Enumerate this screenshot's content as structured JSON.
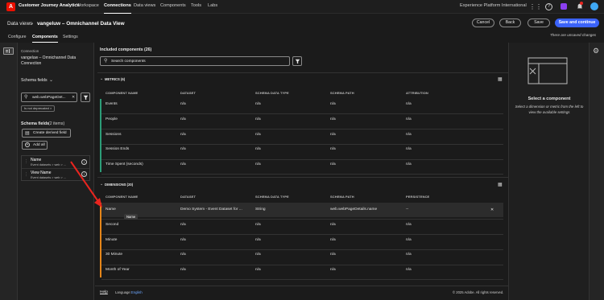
{
  "topnav": {
    "app_title": "Customer Journey Analytics",
    "tabs": [
      "Workspace",
      "Connections",
      "Data views",
      "Components",
      "Tools",
      "Labs"
    ],
    "org": "Experience Platform International",
    "logo_letter": "A"
  },
  "header": {
    "breadcrumb_root": "Data views",
    "breadcrumb_sep": "›",
    "title": "vangeluw – Omnichannel Data View",
    "tabs": [
      "Configure",
      "Components",
      "Settings"
    ],
    "cancel": "Cancel",
    "back": "Back",
    "save": "Save",
    "save_continue": "Save and continue",
    "unsaved": "There are unsaved changes"
  },
  "left": {
    "connection_label": "Connection",
    "connection_value": "vangeluw – Omnichannel Data Connection",
    "schema_dropdown": "Schema fields",
    "search_value": "web.webPageDet...",
    "filter_tag": "Is not deprecated",
    "fields_title": "Schema fields",
    "fields_count": "(2 items)",
    "create_derived": "Create derived field",
    "add_all": "Add all",
    "fields": [
      {
        "name": "Name",
        "path": "Event datasets > web > ..."
      },
      {
        "name": "View Name",
        "path": "Event datasets > web > ..."
      }
    ]
  },
  "main": {
    "included_title": "Included components (26)",
    "search_placeholder": "Search components",
    "metrics_title": "METRICS (6)",
    "dimensions_title": "DIMENSIONS (20)",
    "metric_cols": [
      "COMPONENT NAME",
      "DATASET",
      "SCHEMA DATA TYPE",
      "SCHEMA PATH",
      "ATTRIBUTION"
    ],
    "dimension_cols": [
      "COMPONENT NAME",
      "DATASET",
      "SCHEMA DATA TYPE",
      "SCHEMA PATH",
      "PERSISTENCE"
    ],
    "metrics": [
      [
        "Events",
        "n/a",
        "n/a",
        "n/a",
        "n/a"
      ],
      [
        "People",
        "n/a",
        "n/a",
        "n/a",
        "n/a"
      ],
      [
        "Sessions",
        "n/a",
        "n/a",
        "n/a",
        "n/a"
      ],
      [
        "Session Ends",
        "n/a",
        "n/a",
        "n/a",
        "n/a"
      ],
      [
        "Time Spent (seconds)",
        "n/a",
        "n/a",
        "n/a",
        "n/a"
      ]
    ],
    "dimensions": [
      [
        "Name",
        "Demo System - Event Dataset for ...",
        "String",
        "web.webPageDetails.name",
        "--"
      ],
      [
        "Second",
        "n/a",
        "n/a",
        "n/a",
        "n/a"
      ],
      [
        "Minute",
        "n/a",
        "n/a",
        "n/a",
        "n/a"
      ],
      [
        "30 Minute",
        "n/a",
        "n/a",
        "n/a",
        "n/a"
      ],
      [
        "Month of Year",
        "n/a",
        "n/a",
        "n/a",
        "n/a"
      ]
    ],
    "tooltip": "Name",
    "remove_glyph": "✕",
    "footer_help": "Help",
    "footer_lang_label": "Language:",
    "footer_lang": "English",
    "footer_copy": "© 2025 Adobe. All rights reserved."
  },
  "right": {
    "title": "Select a component",
    "desc": "Select a dimension or metric from the left to view the available settings"
  },
  "colors": {
    "accent": "#3b63fb",
    "metrics_bar": "#2d9d78",
    "dimensions_bar": "#e68619",
    "arrow": "#e8251f"
  }
}
